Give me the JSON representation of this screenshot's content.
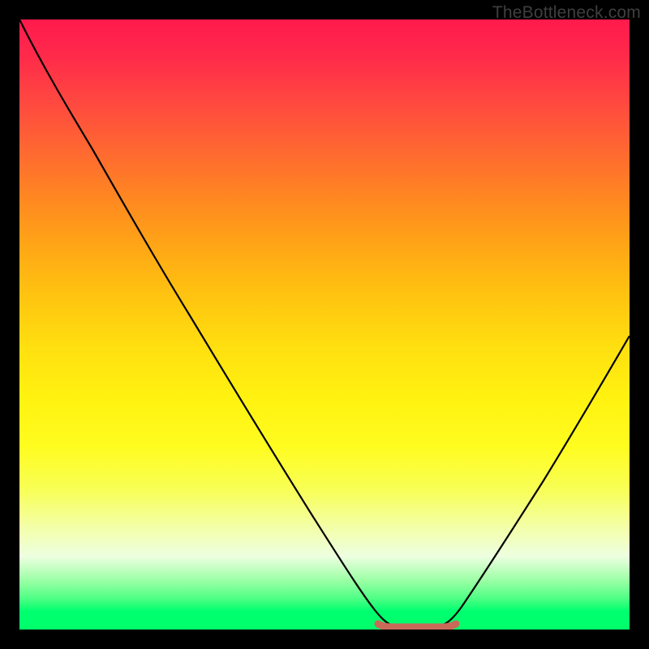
{
  "watermark": "TheBottleneck.com",
  "chart_data": {
    "type": "line",
    "title": "",
    "xlabel": "",
    "ylabel": "",
    "xlim": [
      0,
      100
    ],
    "ylim": [
      0,
      100
    ],
    "grid": false,
    "legend": false,
    "background_gradient": {
      "top": "#ff1a4d",
      "middle": "#ffe010",
      "bottom": "#00ff6a",
      "description": "red at top through orange/yellow to green at bottom"
    },
    "series": [
      {
        "name": "bottleneck-curve",
        "color": "#000000",
        "x": [
          0,
          5,
          10,
          15,
          20,
          25,
          30,
          35,
          40,
          45,
          50,
          55,
          58,
          60,
          63,
          67,
          70,
          72,
          75,
          80,
          85,
          90,
          95,
          100
        ],
        "y": [
          100,
          93,
          86,
          78,
          70,
          62,
          54,
          46,
          38,
          29,
          20,
          11,
          5,
          2,
          0,
          0,
          0,
          2,
          7,
          17,
          27,
          38,
          48,
          58
        ]
      },
      {
        "name": "optimal-range-marker",
        "color": "#cc6a5a",
        "x": [
          58,
          70
        ],
        "y": [
          0.5,
          0.5
        ],
        "style": "thick-flat-segment"
      }
    ],
    "annotations": []
  }
}
